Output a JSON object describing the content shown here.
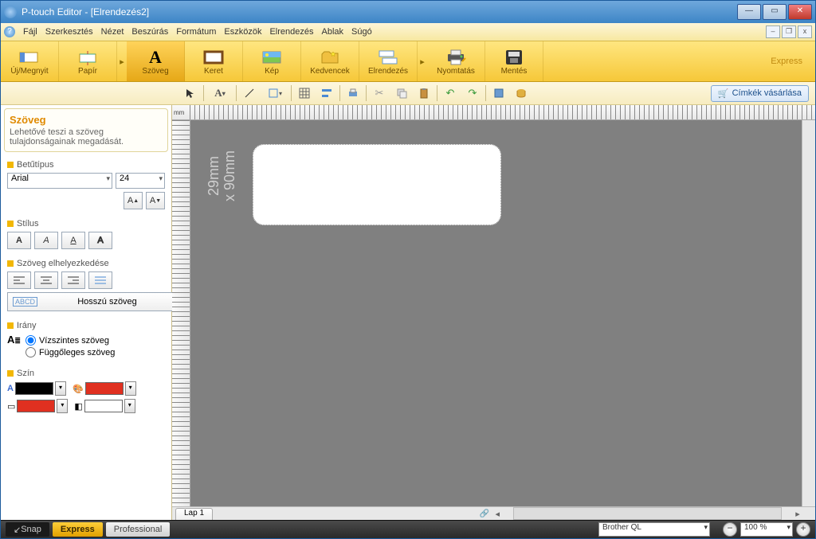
{
  "title": "P-touch Editor - [Elrendezés2]",
  "menus": [
    "Fájl",
    "Szerkesztés",
    "Nézet",
    "Beszúrás",
    "Formátum",
    "Eszközök",
    "Elrendezés",
    "Ablak",
    "Súgó"
  ],
  "ribbon": {
    "groups": [
      {
        "id": "new-open",
        "label": "Új/Megnyit"
      },
      {
        "id": "paper",
        "label": "Papír"
      },
      {
        "id": "text",
        "label": "Szöveg"
      },
      {
        "id": "frame",
        "label": "Keret"
      },
      {
        "id": "image",
        "label": "Kép"
      },
      {
        "id": "favorites",
        "label": "Kedvencek"
      },
      {
        "id": "layout",
        "label": "Elrendezés"
      },
      {
        "id": "print",
        "label": "Nyomtatás"
      },
      {
        "id": "save",
        "label": "Mentés"
      }
    ],
    "express": "Express"
  },
  "buyLabels": "Címkék vásárlása",
  "panel": {
    "title": "Szöveg",
    "desc": "Lehetővé teszi a szöveg tulajdonságainak megadását.",
    "fontSection": "Betűtípus",
    "fontName": "Arial",
    "fontSize": "24",
    "styleSection": "Stílus",
    "alignSection": "Szöveg elhelyezkedése",
    "longText": "Hosszú szöveg",
    "directionSection": "Irány",
    "horizText": "Vízszintes szöveg",
    "vertText": "Függőleges szöveg",
    "colorSection": "Szín"
  },
  "canvas": {
    "unit": "mm",
    "dimension": "29mm\nx 90mm",
    "sheet": "Lap 1"
  },
  "footer": {
    "snap": "Snap",
    "express": "Express",
    "professional": "Professional",
    "printer": "Brother QL",
    "zoom": "100 %"
  }
}
